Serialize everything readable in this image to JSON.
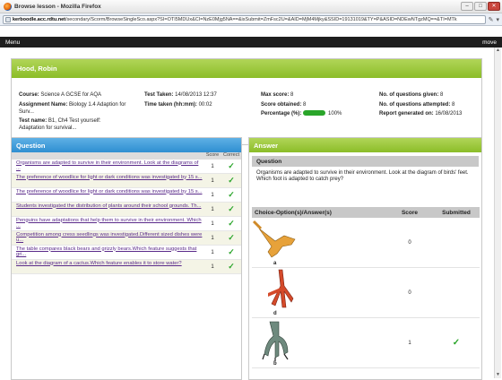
{
  "window": {
    "title": "Browse lesson - Mozilla Firefox",
    "url_host": "kerboodle.acc.rdtu.net",
    "url_path": "/secondary/Scorm/BrowseSingleSco.aspx?SI=OTI5MDUx&CI=NzE0Mjg5NA==&isSubmit=ZmFsc2U=&AID=MjM4Mjky&SSID=19131019&TY=P&ASID=NDEwNTgzMQ==&TI=MTk"
  },
  "menubar": {
    "left": "Menu",
    "right": "move"
  },
  "student": {
    "name": "Hood, Robin"
  },
  "info": {
    "course_label": "Course:",
    "course": "Science A GCSE for AQA",
    "assignment_label": "Assignment Name:",
    "assignment": "Biology 1.4 Adaption for Surv...",
    "test_label": "Test name:",
    "test": "B1, Ch4 Test yourself: Adaptation for survival...",
    "taken_label": "Test Taken:",
    "taken": "14/08/2013 12:37",
    "time_label": "Time taken (hh:mm):",
    "time": "00:02",
    "max_label": "Max score:",
    "max": "8",
    "obtained_label": "Score obtained:",
    "obtained": "8",
    "pct_label": "Percentage (%):",
    "pct": "100%",
    "pct_value": 1.0,
    "given_label": "No. of questions given:",
    "given": "8",
    "attempted_label": "No. of questions attempted:",
    "attempted": "8",
    "report_label": "Report generated on:",
    "report": "16/08/2013"
  },
  "questions": {
    "title": "Question",
    "col_score": "Score",
    "col_correct": "Correct",
    "rows": [
      {
        "text": "Organisms are adapted to survive in their environment. Look at the diagrams of ...",
        "score": "1",
        "correct": "✓"
      },
      {
        "text": "The preference of woodlice for light or dark conditions was investigated by 15 s...",
        "score": "1",
        "correct": "✓"
      },
      {
        "text": "The preference of woodlice for light or dark conditions was investigated by 15 s...",
        "score": "1",
        "correct": "✓"
      },
      {
        "text": "Students investigated the distribution of plants around their school grounds. Th...",
        "score": "1",
        "correct": "✓"
      },
      {
        "text": "Penguins have adaptations that help them to survive in their environment. Which ...",
        "score": "1",
        "correct": "✓"
      },
      {
        "text": "Competition among cress seedlings was investigated.Different sized dishes were u...",
        "score": "1",
        "correct": "✓"
      },
      {
        "text": "The table compares black bears and grizzly bears.Which feature suggests that gri...",
        "score": "1",
        "correct": "✓"
      },
      {
        "text": "Look at the diagram of a cactus.Which feature enables it to store water?",
        "score": "1",
        "correct": "✓"
      }
    ]
  },
  "answer": {
    "title": "Answer",
    "question_heading": "Question",
    "question_text": "Organisms are adapted to survive in their environment. Look at the diagram of birds' feet. Which foot is adapted to catch prey?",
    "col_choice": "Choice-Option(s)/Answer(s)",
    "col_score": "Score",
    "col_submitted": "Submitted",
    "choices": [
      {
        "label": "a",
        "score": "0",
        "submitted": ""
      },
      {
        "label": "d",
        "score": "0",
        "submitted": ""
      },
      {
        "label": "b",
        "score": "1",
        "submitted": "✓"
      }
    ]
  }
}
